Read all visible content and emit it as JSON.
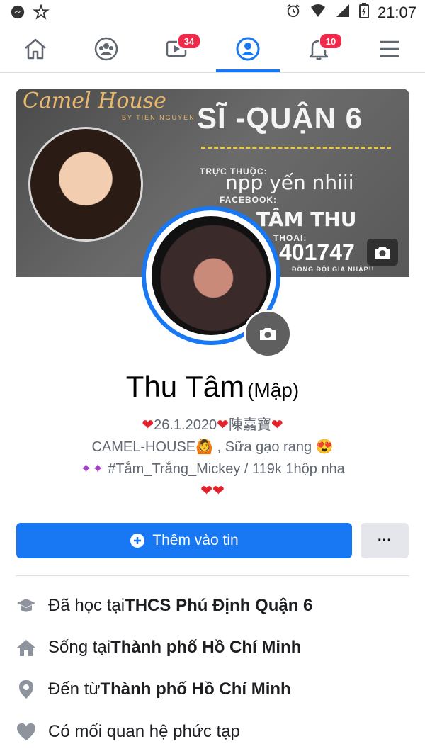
{
  "status_bar": {
    "time": "21:07"
  },
  "nav": {
    "video_badge": "34",
    "notifications_badge": "10"
  },
  "cover": {
    "brand": "Camel House",
    "brand_sub": "BY TIEN NGUYEN",
    "headline": "SĨ -QUẬN 6",
    "affiliation_label": "TRỰC THUỘC:",
    "affiliation_value": "npp yến nhiii",
    "facebook_label": "FACEBOOK:",
    "facebook_value": "TÂM THU",
    "phone_label": "THOẠI:",
    "phone_value": "401747",
    "footer_line": "ĐỒNG ĐỘI GIA NHẬP!!"
  },
  "profile": {
    "name": "Thu Tâm",
    "nickname": "(Mập)",
    "bio_line1": "26.1.2020",
    "bio_line1_cjk": "陳嘉寶",
    "bio_line2_a": "CAMEL-HOUSE",
    "bio_line2_b": " , Sữa gạo rang ",
    "bio_line3": " #Tắm_Trắng_Mickey / 119k 1hộp nha"
  },
  "actions": {
    "add_story": "Thêm vào tin",
    "more": "···"
  },
  "info": [
    {
      "prefix": "Đã học tại ",
      "value": "THCS Phú Định Quận 6",
      "icon": "graduation-cap-icon"
    },
    {
      "prefix": "Sống tại ",
      "value": "Thành phố Hồ Chí Minh",
      "icon": "home-icon"
    },
    {
      "prefix": "Đến từ ",
      "value": "Thành phố Hồ Chí Minh",
      "icon": "location-pin-icon"
    },
    {
      "prefix": "Có mối quan hệ phức tạp",
      "value": "",
      "icon": "heart-icon"
    }
  ],
  "colors": {
    "accent": "#1877f2",
    "badge": "#f02849",
    "heart": "#e3222b"
  }
}
